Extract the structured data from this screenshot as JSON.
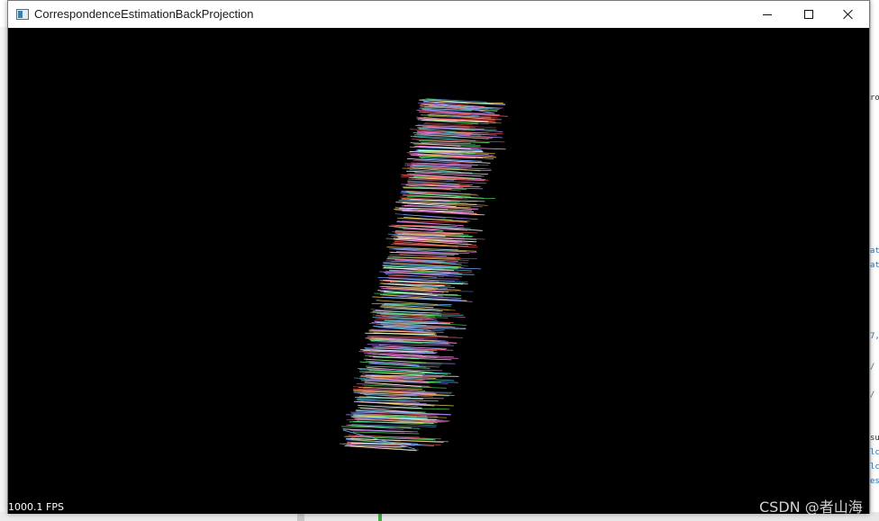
{
  "window": {
    "title": "CorrespondenceEstimationBackProjection",
    "controls": {
      "minimize": "minimize",
      "maximize": "maximize",
      "close": "close"
    }
  },
  "viewport": {
    "background": "#000000",
    "fps_label": "1000.1 FPS",
    "line_colors": [
      "#ff5a5a",
      "#5aff6e",
      "#6fa8ff",
      "#ff7de0",
      "#b38cff",
      "#ffffff",
      "#57e0e0",
      "#ffd25a"
    ]
  },
  "background_app": {
    "snippets": [
      "ro",
      "at",
      "at",
      "7,",
      "/",
      "/",
      "su",
      "lc",
      "lc",
      "es"
    ]
  },
  "watermark": "CSDN @者山海"
}
